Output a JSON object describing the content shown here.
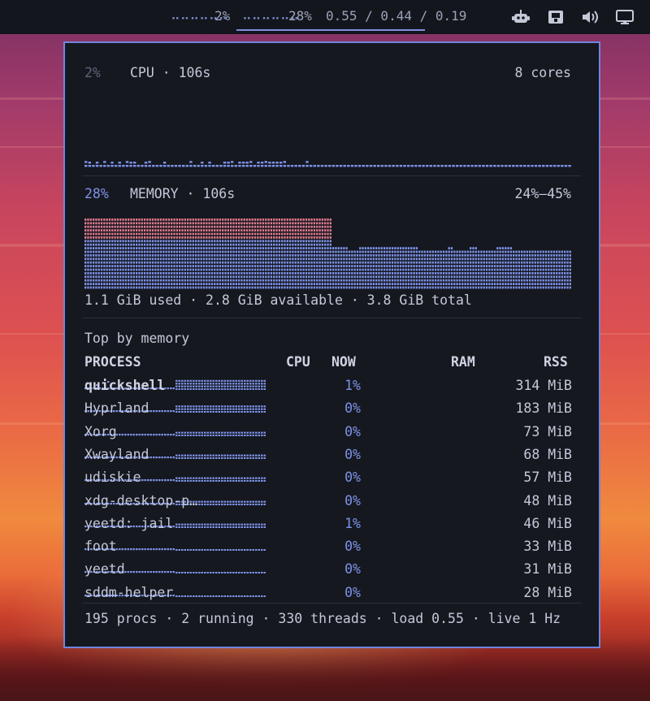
{
  "topbar": {
    "cpu_percent": "2%",
    "mem_percent": "28%",
    "load_text": "0.55 / 0.44 / 0.19",
    "icons": [
      "robot-icon",
      "disk-icon",
      "volume-icon",
      "monitor-icon"
    ]
  },
  "cpu": {
    "percent": "2%",
    "label": "CPU · 106s",
    "cores": "8 cores",
    "history": [
      0.12,
      0.1,
      0,
      0.1,
      0,
      0.12,
      0,
      0.1,
      0,
      0.1,
      0,
      0.12,
      0.1,
      0.1,
      0,
      0,
      0.1,
      0.12,
      0,
      0,
      0,
      0.1,
      0,
      0,
      0,
      0,
      0,
      0,
      0.12,
      0,
      0,
      0.1,
      0,
      0.1,
      0,
      0,
      0,
      0.1,
      0.1,
      0.12,
      0,
      0.1,
      0.1,
      0.1,
      0.12,
      0,
      0.1,
      0.1,
      0.12,
      0.1,
      0.1,
      0.1,
      0.1,
      0.12,
      0,
      0,
      0,
      0,
      0,
      0.12,
      0,
      0,
      0,
      0,
      0,
      0,
      0,
      0,
      0,
      0,
      0,
      0,
      0,
      0,
      0,
      0,
      0,
      0,
      0,
      0,
      0,
      0,
      0,
      0,
      0,
      0,
      0,
      0,
      0,
      0,
      0,
      0,
      0,
      0,
      0,
      0,
      0,
      0,
      0,
      0,
      0,
      0,
      0,
      0,
      0,
      0,
      0,
      0,
      0,
      0,
      0,
      0,
      0,
      0,
      0,
      0,
      0,
      0,
      0,
      0,
      0,
      0,
      0,
      0,
      0,
      0,
      0,
      0,
      0,
      0
    ]
  },
  "memory": {
    "percent": "28%",
    "label": "MEMORY · 106s",
    "range": "24%–45%",
    "summary": "1.1 GiB used · 2.8 GiB available · 3.8 GiB total",
    "history": [
      45,
      45,
      44,
      44,
      44,
      44,
      44,
      44,
      44,
      44,
      44,
      44,
      44,
      44,
      44,
      44,
      44,
      44,
      44,
      44,
      44,
      44,
      44,
      44,
      45,
      45,
      45,
      45,
      45,
      45,
      44,
      44,
      44,
      44,
      44,
      44,
      44,
      44,
      44,
      44,
      44,
      44,
      44,
      44,
      44,
      44,
      44,
      44,
      44,
      44,
      44,
      44,
      44,
      44,
      44,
      44,
      44,
      44,
      44,
      44,
      44,
      44,
      44,
      44,
      44,
      44,
      44,
      44,
      44,
      44,
      44,
      44,
      44,
      44,
      44,
      44,
      45,
      45,
      45,
      45,
      45,
      45,
      44,
      44,
      44,
      44,
      44,
      44,
      44,
      44,
      44,
      44,
      27,
      27,
      27,
      27,
      27,
      27,
      24,
      24,
      24,
      24,
      27,
      27,
      27,
      27,
      27,
      27,
      27,
      27,
      27,
      27,
      27,
      27,
      27,
      27,
      27,
      27,
      26,
      26,
      26,
      26,
      26,
      26,
      24,
      24,
      24,
      24,
      24,
      24,
      24,
      24,
      24,
      24,
      24,
      26,
      26,
      24,
      24,
      24,
      24,
      24,
      24,
      26,
      26,
      26,
      24,
      24,
      24,
      24,
      24,
      24,
      24,
      26,
      26,
      27,
      27,
      27,
      27,
      24,
      24,
      24,
      24,
      24,
      24,
      24,
      24,
      24,
      24,
      24,
      24,
      24,
      24,
      24,
      24,
      24,
      24,
      24,
      24,
      24,
      24
    ]
  },
  "table": {
    "title": "Top by memory",
    "headers": {
      "process": "PROCESS",
      "cpu": "CPU",
      "now": "NOW",
      "ram": "RAM",
      "rss": "RSS"
    },
    "rows": [
      {
        "name": "quickshell",
        "now": "1%",
        "rss": "314 MiB",
        "cpu_spark": [
          0,
          0,
          0,
          0,
          0.5,
          0,
          0,
          0,
          1,
          0.5,
          0,
          0,
          0,
          0,
          0,
          0,
          0,
          0,
          0,
          0,
          0,
          0,
          0,
          0,
          0,
          0,
          0,
          0,
          0,
          0,
          0,
          0
        ],
        "ram_level": 1.0
      },
      {
        "name": "Hyprland",
        "now": "0%",
        "rss": "183 MiB",
        "cpu_spark": [],
        "ram_level": 0.58
      },
      {
        "name": "Xorg",
        "now": "0%",
        "rss": "73 MiB",
        "cpu_spark": [],
        "ram_level": 0.45
      },
      {
        "name": "Xwayland",
        "now": "0%",
        "rss": "68 MiB",
        "cpu_spark": [],
        "ram_level": 0.45
      },
      {
        "name": "udiskie",
        "now": "0%",
        "rss": "57 MiB",
        "cpu_spark": [],
        "ram_level": 0.45
      },
      {
        "name": "xdg-desktop-p…",
        "now": "0%",
        "rss": "48 MiB",
        "cpu_spark": [],
        "ram_level": 0.45
      },
      {
        "name": "yeetd: jail",
        "now": "1%",
        "rss": "46 MiB",
        "cpu_spark": [],
        "ram_level": 0.45
      },
      {
        "name": "foot",
        "now": "0%",
        "rss": "33 MiB",
        "cpu_spark": [],
        "ram_level": 0.2
      },
      {
        "name": "yeetd",
        "now": "0%",
        "rss": "31 MiB",
        "cpu_spark": [],
        "ram_level": 0.2
      },
      {
        "name": "sddm-helper",
        "now": "0%",
        "rss": "28 MiB",
        "cpu_spark": [],
        "ram_level": 0.2
      }
    ]
  },
  "footer": "195 procs · 2 running · 330 threads · load 0.55 · live 1 Hz",
  "colors": {
    "accent": "#7d93e8",
    "memory_peak": "#e07a8e",
    "border": "#6f86df",
    "panel_bg": "#161820"
  }
}
